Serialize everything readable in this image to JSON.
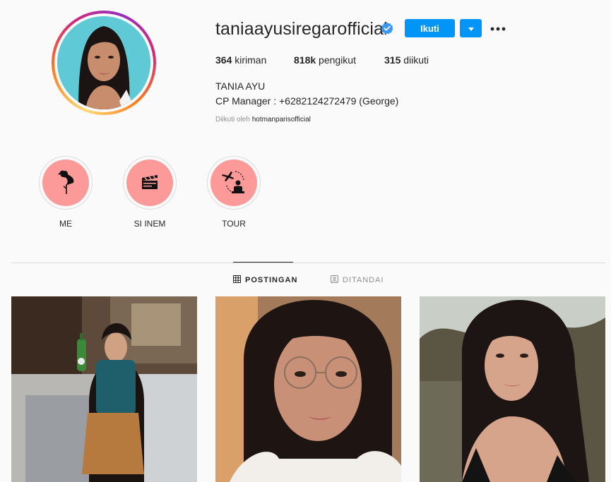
{
  "profile": {
    "username": "taniaayusiregarofficial",
    "follow_label": "Ikuti",
    "stats": {
      "posts_count": "364",
      "posts_label": "kiriman",
      "followers_count": "818k",
      "followers_label": "pengikut",
      "following_count": "315",
      "following_label": "diikuti"
    },
    "full_name": "TANIA AYU",
    "bio": "CP Manager : +6282124272479 (George)",
    "followed_by_prefix": "Diikuti oleh",
    "followed_by_user": "hotmanparisofficial"
  },
  "highlights": [
    {
      "label": "ME",
      "icon": "flamingo-icon"
    },
    {
      "label": "SI INEM",
      "icon": "clapperboard-icon"
    },
    {
      "label": "TOUR",
      "icon": "travel-icon"
    }
  ],
  "tabs": [
    {
      "label": "POSTINGAN",
      "icon": "grid-icon",
      "active": true
    },
    {
      "label": "DITANDAI",
      "icon": "tagged-icon",
      "active": false
    }
  ],
  "colors": {
    "accent": "#0095f6",
    "highlight_bg": "#fc9a9a",
    "text": "#262626",
    "muted": "#8e8e8e"
  }
}
